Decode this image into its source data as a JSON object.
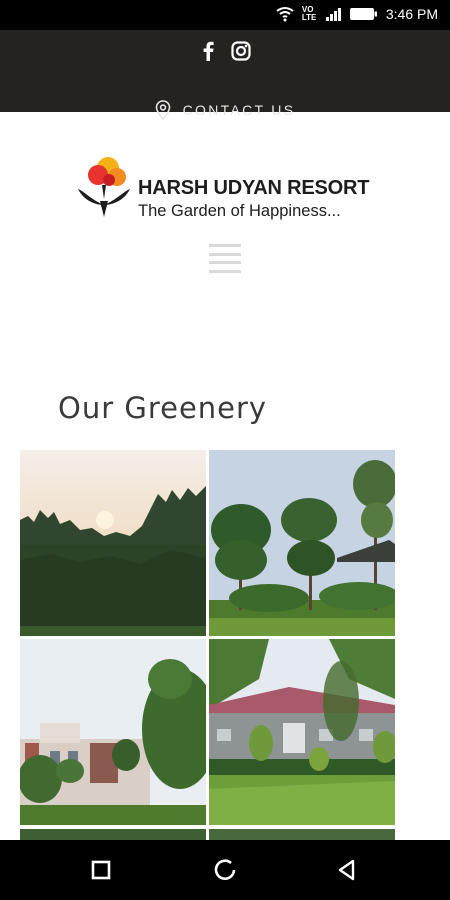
{
  "status_bar": {
    "time": "3:46 PM",
    "network_label": "VOLTE",
    "icons": [
      "wifi-icon",
      "volte-icon",
      "signal-icon",
      "battery-icon"
    ]
  },
  "header": {
    "social_icons": [
      "facebook-icon",
      "instagram-icon"
    ],
    "contact_label": "CONTACT US"
  },
  "brand": {
    "title": "HARSH UDYAN RESORT",
    "tagline": "The Garden of Happiness...",
    "logo_icon": "tree-hands-logo"
  },
  "menu": {
    "icon": "hamburger-menu-icon"
  },
  "section": {
    "title": "Our Greenery"
  },
  "gallery": {
    "images": [
      "sunset-over-trees-photo",
      "tall-trees-garden-photo",
      "resort-building-trees-photo",
      "cottage-lawn-photo"
    ]
  },
  "nav_bar": {
    "buttons": [
      "recent-apps-icon",
      "home-icon",
      "back-icon"
    ]
  },
  "colors": {
    "header_bg": "#252222",
    "title_text": "#3a3a3a",
    "menu_lines": "#d9d9d9"
  }
}
